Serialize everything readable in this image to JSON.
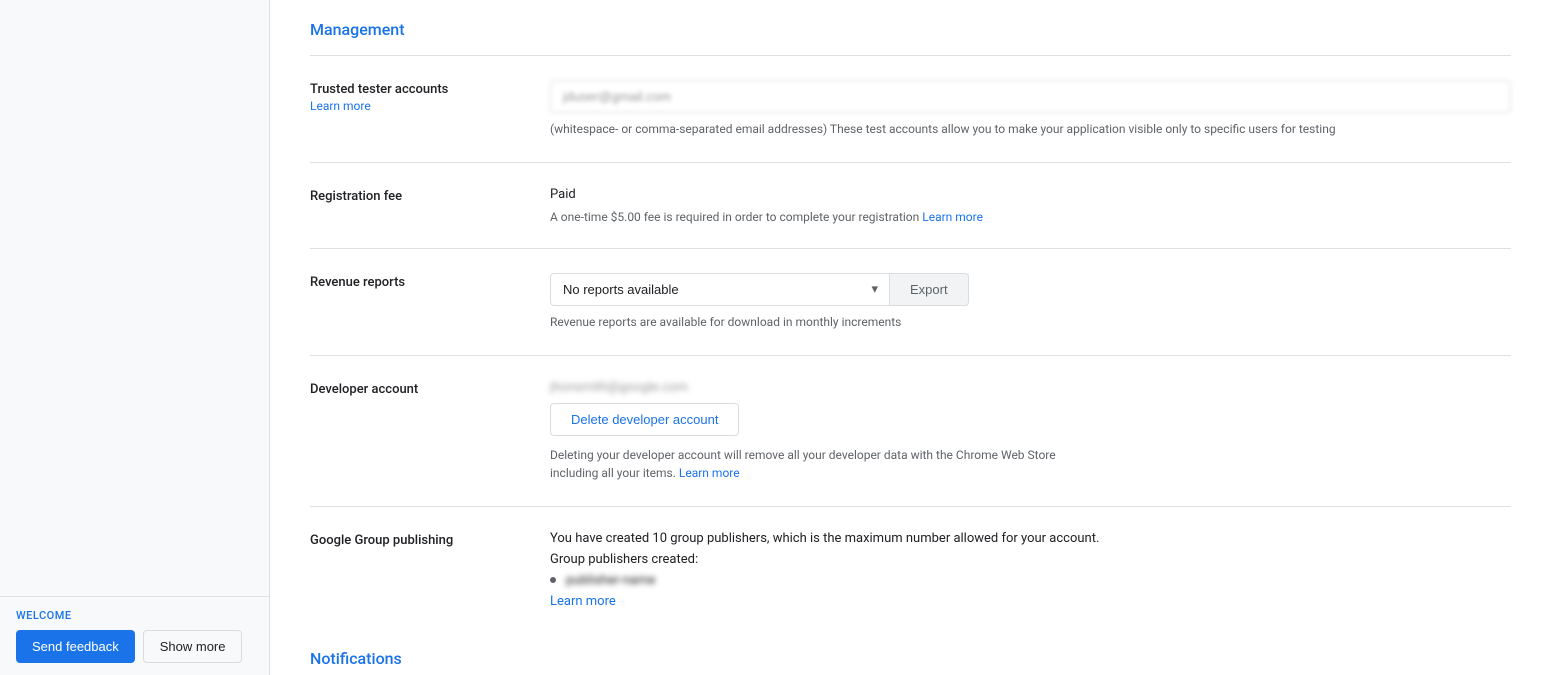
{
  "sidebar": {
    "welcome_label": "WELCOME",
    "send_feedback_label": "Send feedback",
    "show_more_label": "Show more"
  },
  "management": {
    "section_title": "Management",
    "trusted_tester": {
      "label": "Trusted tester accounts",
      "learn_more": "Learn more",
      "input_value": "jduser@gmail.com",
      "hint": "(whitespace- or comma-separated email addresses) These test accounts allow you to make your application visible only to specific users for testing"
    },
    "registration_fee": {
      "label": "Registration fee",
      "status": "Paid",
      "hint_prefix": "A one-time $5.00 fee is required in order to complete your registration",
      "learn_more": "Learn more"
    },
    "revenue_reports": {
      "label": "Revenue reports",
      "select_value": "No reports available",
      "export_label": "Export",
      "hint": "Revenue reports are available for download in monthly increments"
    },
    "developer_account": {
      "label": "Developer account",
      "email_blurred": "jhonsmith@google.com",
      "delete_button_label": "Delete developer account",
      "delete_hint_prefix": "Deleting your developer account will remove all your developer data with the Chrome Web Store including all your items.",
      "learn_more": "Learn more"
    },
    "google_group_publishing": {
      "label": "Google Group publishing",
      "description": "You have created 10 group publishers, which is the maximum number allowed for your account.",
      "publishers_label": "Group publishers created:",
      "publisher_item": "publisher-name",
      "learn_more": "Learn more"
    }
  },
  "notifications": {
    "section_title": "Notifications"
  },
  "icons": {
    "chevron_down": "▾"
  },
  "colors": {
    "blue": "#1a73e8",
    "text_primary": "#202124",
    "text_secondary": "#5f6368",
    "border": "#dadce0",
    "bg_light": "#f8f9fa"
  }
}
